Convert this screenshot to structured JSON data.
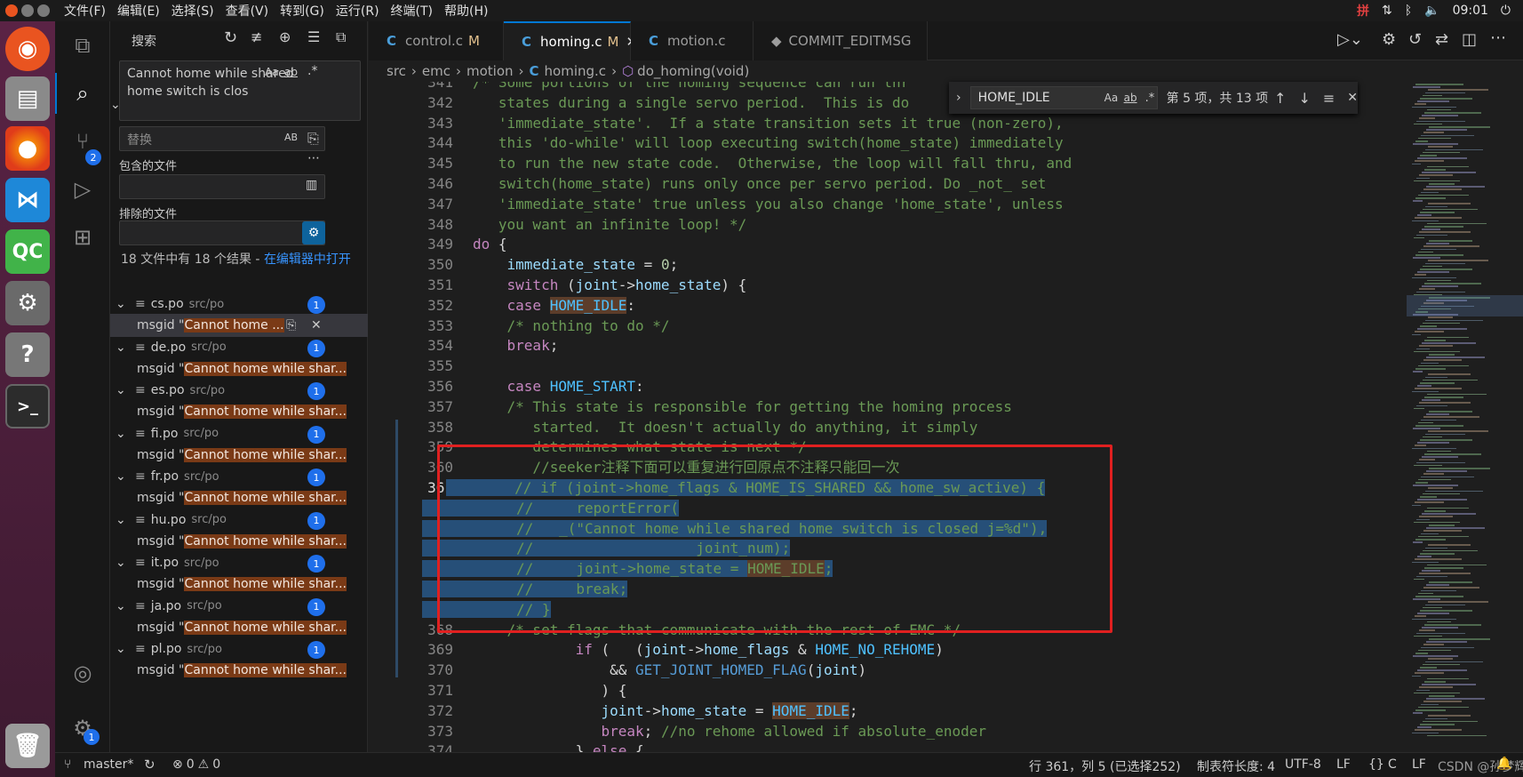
{
  "menu": [
    "文件(F)",
    "编辑(E)",
    "选择(S)",
    "查看(V)",
    "转到(G)",
    "运行(R)",
    "终端(T)",
    "帮助(H)"
  ],
  "tray": {
    "ime": "拼",
    "time": "09:01"
  },
  "dock": [
    "ubuntu-icon",
    "files-icon",
    "firefox-icon",
    "vscode-icon",
    "qt-creator-icon",
    "settings-icon",
    "help-icon",
    "terminal-icon",
    "trash-icon"
  ],
  "dock_qt_label": "QC",
  "activity": {
    "scm_badge": "2",
    "settings_badge": "1"
  },
  "search": {
    "title": "搜索",
    "query": "Cannot home while shared home switch is clos",
    "replace_placeholder": "替换",
    "include_label": "包含的文件",
    "exclude_label": "排除的文件",
    "summary": "18 文件中有 18 个结果 - ",
    "summary_link": "在编辑器中打开",
    "aa": "Aa",
    "ab": "ab",
    "regex": ".*",
    "AB": "AB",
    "results": [
      {
        "file": "cs.po",
        "path": "src/po",
        "count": "1",
        "prefix": "msgid \"",
        "match": "Cannot home ..."
      },
      {
        "file": "de.po",
        "path": "src/po",
        "count": "1",
        "prefix": "msgid \"",
        "match": "Cannot home while shar..."
      },
      {
        "file": "es.po",
        "path": "src/po",
        "count": "1",
        "prefix": "msgid \"",
        "match": "Cannot home while shar..."
      },
      {
        "file": "fi.po",
        "path": "src/po",
        "count": "1",
        "prefix": "msgid \"",
        "match": "Cannot home while shar..."
      },
      {
        "file": "fr.po",
        "path": "src/po",
        "count": "1",
        "prefix": "msgid \"",
        "match": "Cannot home while shar..."
      },
      {
        "file": "hu.po",
        "path": "src/po",
        "count": "1",
        "prefix": "msgid \"",
        "match": "Cannot home while shar..."
      },
      {
        "file": "it.po",
        "path": "src/po",
        "count": "1",
        "prefix": "msgid \"",
        "match": "Cannot home while shar..."
      },
      {
        "file": "ja.po",
        "path": "src/po",
        "count": "1",
        "prefix": "msgid \"",
        "match": "Cannot home while shar..."
      },
      {
        "file": "pl.po",
        "path": "src/po",
        "count": "1",
        "prefix": "msgid \"",
        "match": "Cannot home while shar..."
      }
    ]
  },
  "tabs": [
    {
      "label": "control.c",
      "status": "M"
    },
    {
      "label": "homing.c",
      "status": "M"
    },
    {
      "label": "motion.c",
      "status": ""
    },
    {
      "label": "COMMIT_EDITMSG",
      "status": ""
    }
  ],
  "breadcrumb": {
    "a": "src",
    "b": "emc",
    "c": "motion",
    "d": "homing.c",
    "e": "do_homing(void)"
  },
  "find": {
    "query": "HOME_IDLE",
    "result": "第 5 项，共 13 项"
  },
  "status": {
    "branch": "master*",
    "problems": "0",
    "warnings": "0",
    "position": "行 361，列 5 (已选择252)",
    "tab": "制表符长度: 4",
    "encoding": "UTF-8",
    "eol": "LF",
    "lang": "C",
    "watermark": "CSDN @孙梦辉",
    "lf2": "LF"
  }
}
